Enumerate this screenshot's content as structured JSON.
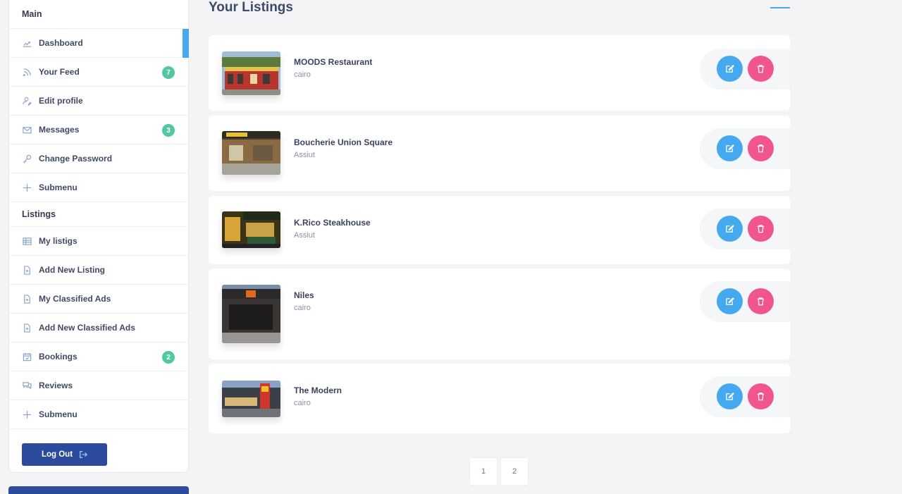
{
  "sidebar": {
    "main_title": "Main",
    "main_items": [
      {
        "label": "Dashboard",
        "icon": "chart-icon",
        "badge": null,
        "active": true
      },
      {
        "label": "Your Feed",
        "icon": "rss-icon",
        "badge": "7"
      },
      {
        "label": "Edit profile",
        "icon": "user-edit-icon",
        "badge": null
      },
      {
        "label": "Messages",
        "icon": "envelope-icon",
        "badge": "3"
      },
      {
        "label": "Change Password",
        "icon": "key-icon",
        "badge": null
      },
      {
        "label": "Submenu",
        "icon": "plus-icon",
        "badge": null
      }
    ],
    "listings_title": "Listings",
    "listing_items": [
      {
        "label": "My listigs",
        "icon": "grid-icon",
        "badge": null
      },
      {
        "label": "Add New Listing",
        "icon": "file-plus-icon",
        "badge": null
      },
      {
        "label": "My Classified Ads",
        "icon": "file-plus-icon",
        "badge": null
      },
      {
        "label": "Add New Classified Ads",
        "icon": "file-plus-icon",
        "badge": null
      },
      {
        "label": "Bookings",
        "icon": "calendar-check-icon",
        "badge": "2"
      },
      {
        "label": "Reviews",
        "icon": "chat-icon",
        "badge": null
      },
      {
        "label": "Submenu",
        "icon": "plus-icon",
        "badge": null
      }
    ],
    "logout_label": "Log Out",
    "accent_color": "#4aa8f2",
    "badge_color": "#53c7a2"
  },
  "main": {
    "title": "Your Listings",
    "listings": [
      {
        "name": "MOODS Restaurant",
        "city": "cairo"
      },
      {
        "name": "Boucherie Union Square",
        "city": "Assiut"
      },
      {
        "name": "K.Rico Steakhouse",
        "city": "Assiut"
      },
      {
        "name": "Niles",
        "city": "cairo"
      },
      {
        "name": "The Modern",
        "city": "cairo"
      }
    ],
    "pagination": [
      "1",
      "2"
    ],
    "edit_color": "#45a9f0",
    "delete_color": "#f0568d"
  }
}
